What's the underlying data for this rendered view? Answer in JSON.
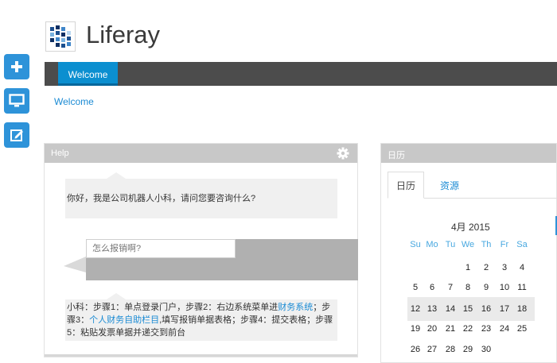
{
  "app": {
    "logo_text": "Liferay"
  },
  "dock": {
    "items": [
      "add-icon",
      "monitor-icon",
      "edit-icon"
    ]
  },
  "nav": {
    "tabs": [
      "Welcome"
    ]
  },
  "breadcrumb": "Welcome",
  "help": {
    "title": "Help",
    "greeting": "你好，我是公司机器人小科，请问您要咨询什么?",
    "input_placeholder": "怎么报销啊?",
    "answer_part1": "小科：步骤1：单点登录门户，步骤2：右边系统菜单进",
    "answer_link1": "财务系统",
    "answer_part2": "；步骤3：",
    "answer_link2": "个人财务自助栏目",
    "answer_part3": ",填写报销单据表格；步骤4：提交表格；步骤5：粘贴发票单据并递交到前台"
  },
  "calendar": {
    "title": "日历",
    "tabs": [
      "日历",
      "资源"
    ],
    "month": "4月 2015",
    "weekdays": [
      "Su",
      "Mo",
      "Tu",
      "We",
      "Th",
      "Fr",
      "Sa"
    ],
    "weeks": [
      [
        "",
        "",
        "",
        "1",
        "2",
        "3",
        "4"
      ],
      [
        "5",
        "6",
        "7",
        "8",
        "9",
        "10",
        "11"
      ],
      [
        "12",
        "13",
        "14",
        "15",
        "16",
        "17",
        "18"
      ],
      [
        "19",
        "20",
        "21",
        "22",
        "23",
        "24",
        "25"
      ],
      [
        "26",
        "27",
        "28",
        "29",
        "30",
        "",
        ""
      ]
    ]
  },
  "colors": {
    "accent": "#0b8fd0",
    "dock": "#2e93d9",
    "nav": "#4c4c4c",
    "portlet_header": "#c8c8c8"
  }
}
